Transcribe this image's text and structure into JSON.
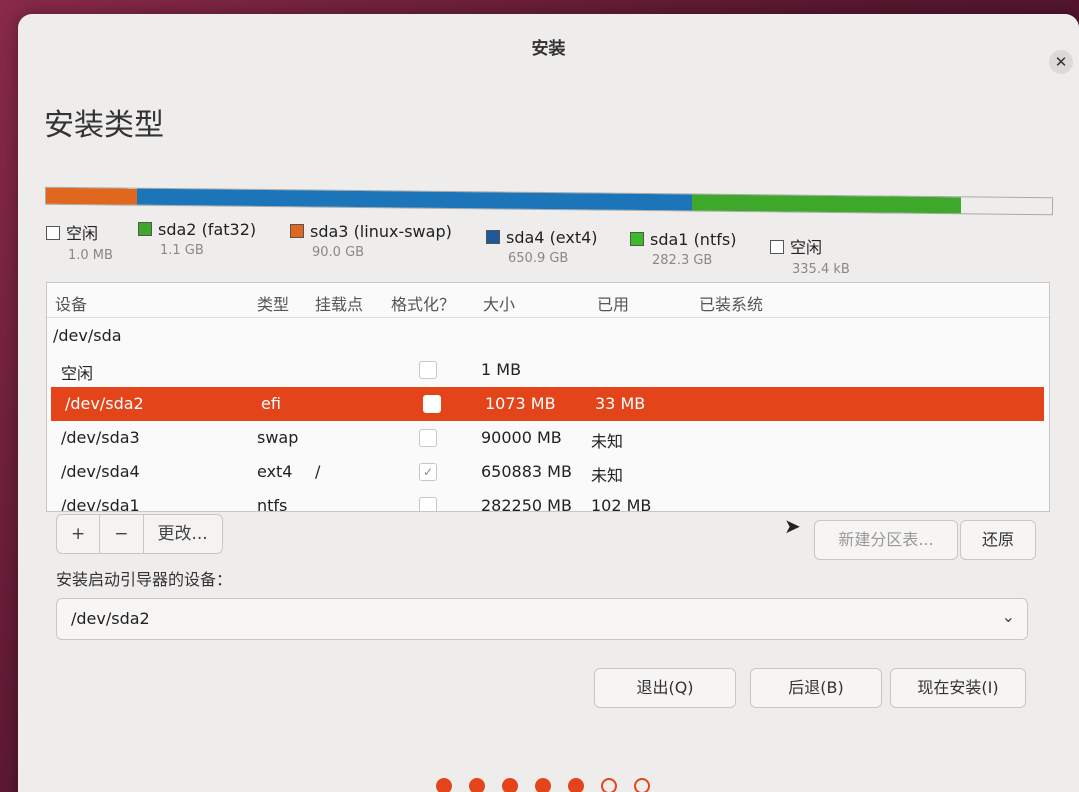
{
  "window": {
    "title": "安装"
  },
  "page_title": "安装类型",
  "disk_bar": {
    "segments": [
      {
        "color": "#e0681e",
        "fraction": 0.09
      },
      {
        "color": "#1b75b8",
        "fraction": 0.552
      },
      {
        "color": "#3da82a",
        "fraction": 0.268
      }
    ]
  },
  "legend": [
    {
      "name": "空闲",
      "size": "1.0 MB",
      "color": "#ffffff"
    },
    {
      "name": "sda2 (fat32)",
      "size": "1.1 GB",
      "color": "#3da82a"
    },
    {
      "name": "sda3 (linux-swap)",
      "size": "90.0 GB",
      "color": "#e0681e"
    },
    {
      "name": "sda4 (ext4)",
      "size": "650.9 GB",
      "color": "#1b5a9a"
    },
    {
      "name": "sda1 (ntfs)",
      "size": "282.3 GB",
      "color": "#3dbb2a"
    },
    {
      "name": "空闲",
      "size": "335.4 kB",
      "color": "#ffffff"
    }
  ],
  "table": {
    "headers": [
      "设备",
      "类型",
      "挂载点",
      "格式化？",
      "大小",
      "已用",
      "已装系统"
    ],
    "rows": [
      {
        "device": "/dev/sda",
        "type": "",
        "mount": "",
        "format": null,
        "size": "",
        "used": ""
      },
      {
        "device": "空闲",
        "type": "",
        "mount": "",
        "format": false,
        "size": "1 MB",
        "used": ""
      },
      {
        "device": "/dev/sda2",
        "type": "efi",
        "mount": "",
        "format": false,
        "size": "1073 MB",
        "used": "33 MB",
        "selected": true
      },
      {
        "device": "/dev/sda3",
        "type": "swap",
        "mount": "",
        "format": false,
        "size": "90000 MB",
        "used": "未知"
      },
      {
        "device": "/dev/sda4",
        "type": "ext4",
        "mount": "/",
        "format": true,
        "size": "650883 MB",
        "used": "未知"
      },
      {
        "device": "/dev/sda1",
        "type": "ntfs",
        "mount": "",
        "format": false,
        "size": "282250 MB",
        "used": "102 MB"
      }
    ]
  },
  "toolbar": {
    "add": "+",
    "remove": "−",
    "change": "更改..."
  },
  "new_table_label": "新建分区表...",
  "revert_label": "还原",
  "boot": {
    "label": "安装启动引导器的设备：",
    "value": "/dev/sda2"
  },
  "buttons": {
    "quit": "退出(Q)",
    "back": "后退(B)",
    "install": "现在安装(I)"
  },
  "progress_dots": {
    "total": 7,
    "done": 5
  },
  "icons": {
    "close": "close-icon",
    "chevron": "chevron-down-icon",
    "check": "check-icon"
  }
}
